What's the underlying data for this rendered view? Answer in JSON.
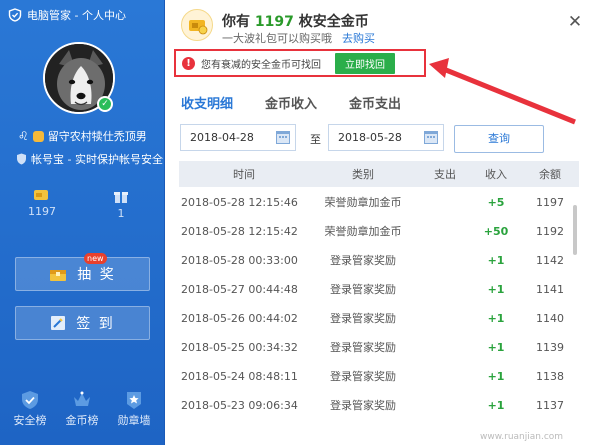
{
  "app": {
    "title": "电脑管家 - 个人中心"
  },
  "profile": {
    "username": "留守农村犊仕禿顶男",
    "security": "帐号宝 - 实时保护帐号安全"
  },
  "stats": [
    {
      "icon": "gold-coin-icon",
      "value": "1197"
    },
    {
      "icon": "gift-icon",
      "value": "1"
    }
  ],
  "actions": {
    "lottery_label": "抽 奖",
    "lottery_tag": "new",
    "checkin_label": "签 到"
  },
  "bottom_nav": [
    {
      "icon": "shield-icon",
      "label": "安全榜"
    },
    {
      "icon": "crown-icon",
      "label": "金币榜"
    },
    {
      "icon": "medal-icon",
      "label": "勋章墙"
    }
  ],
  "header": {
    "prefix": "你有",
    "coins": "1197",
    "suffix": "枚安全金币",
    "subtitle": "一大波礼包可以购买哦",
    "buy_link": "去购买"
  },
  "alert": {
    "text": "您有衰减的安全金币可找回",
    "button": "立即找回"
  },
  "tabs": [
    "收支明细",
    "金币收入",
    "金币支出"
  ],
  "filters": {
    "start_date": "2018-04-28",
    "to_label": "至",
    "end_date": "2018-05-28",
    "query_button": "查询"
  },
  "table": {
    "headers": [
      "时间",
      "类别",
      "支出",
      "收入",
      "余额"
    ],
    "rows": [
      {
        "time": "2018-05-28 12:15:46",
        "type": "荣誉勋章加金币",
        "out": "",
        "in": "+5",
        "balance": "1197"
      },
      {
        "time": "2018-05-28 12:15:42",
        "type": "荣誉勋章加金币",
        "out": "",
        "in": "+50",
        "balance": "1192"
      },
      {
        "time": "2018-05-28 00:33:00",
        "type": "登录管家奖励",
        "out": "",
        "in": "+1",
        "balance": "1142"
      },
      {
        "time": "2018-05-27 00:44:48",
        "type": "登录管家奖励",
        "out": "",
        "in": "+1",
        "balance": "1141"
      },
      {
        "time": "2018-05-26 00:44:02",
        "type": "登录管家奖励",
        "out": "",
        "in": "+1",
        "balance": "1140"
      },
      {
        "time": "2018-05-25 00:34:32",
        "type": "登录管家奖励",
        "out": "",
        "in": "+1",
        "balance": "1139"
      },
      {
        "time": "2018-05-24 08:48:11",
        "type": "登录管家奖励",
        "out": "",
        "in": "+1",
        "balance": "1138"
      },
      {
        "time": "2018-05-23 09:06:34",
        "type": "登录管家奖励",
        "out": "",
        "in": "+1",
        "balance": "1137"
      }
    ]
  },
  "watermark": "www.ruanjian.com",
  "colors": {
    "sidebar": "#2a78d6",
    "accent": "#2a78d6",
    "alert": "#e8323c",
    "income": "#2aa33d"
  }
}
